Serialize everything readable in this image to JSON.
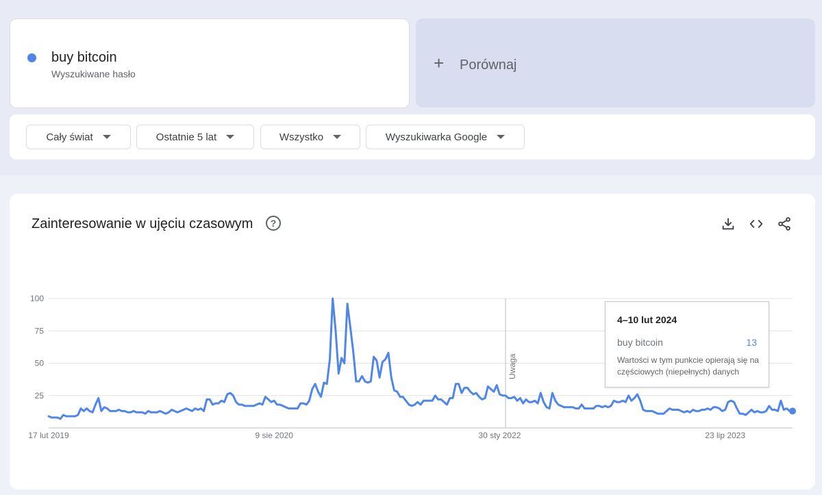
{
  "search_term": {
    "name": "buy bitcoin",
    "subtitle": "Wyszukiwane hasło",
    "color": "#4f86e8"
  },
  "compare": {
    "label": "Porównaj"
  },
  "filters": [
    {
      "label": "Cały świat"
    },
    {
      "label": "Ostatnie 5 lat"
    },
    {
      "label": "Wszystko"
    },
    {
      "label": "Wyszukiwarka Google"
    }
  ],
  "chart_card": {
    "title": "Zainteresowanie w ujęciu czasowym",
    "icons": [
      "help-icon",
      "download-icon",
      "embed-icon",
      "share-icon"
    ]
  },
  "tooltip": {
    "date": "4–10 lut 2024",
    "term": "buy bitcoin",
    "value": "13",
    "note": "Wartości w tym punkcie opierają się na częściowych (niepełnych) danych"
  },
  "chart_data": {
    "type": "line",
    "title": "Zainteresowanie w ujęciu czasowym",
    "xlabel": "",
    "ylabel": "",
    "ylim": [
      0,
      100
    ],
    "yticks": [
      25,
      50,
      75,
      100
    ],
    "x_tick_labels": [
      "17 lut 2019",
      "9 sie 2020",
      "30 sty 2022",
      "23 lip 2023"
    ],
    "x_tick_weeks": [
      0,
      77,
      154,
      231
    ],
    "annotation": {
      "label": "Uwaga",
      "week": 156
    },
    "grid": true,
    "series": [
      {
        "name": "buy bitcoin",
        "color": "#4f86e8",
        "values": [
          9,
          8,
          8,
          8,
          7,
          10,
          9,
          9,
          9,
          9,
          10,
          15,
          13,
          15,
          13,
          12,
          18,
          23,
          13,
          16,
          15,
          13,
          13,
          13,
          14,
          13,
          13,
          12,
          12,
          13,
          12,
          12,
          12,
          11,
          13,
          12,
          12,
          12,
          13,
          12,
          11,
          12,
          14,
          13,
          12,
          13,
          14,
          15,
          14,
          13,
          15,
          14,
          15,
          13,
          22,
          22,
          18,
          19,
          19,
          21,
          20,
          26,
          27,
          25,
          20,
          18,
          18,
          17,
          17,
          17,
          17,
          18,
          19,
          18,
          24,
          22,
          20,
          21,
          18,
          18,
          17,
          16,
          15,
          15,
          15,
          15,
          19,
          19,
          18,
          21,
          30,
          34,
          28,
          24,
          35,
          34,
          53,
          100,
          75,
          42,
          54,
          50,
          96,
          78,
          59,
          36,
          36,
          40,
          36,
          35,
          36,
          55,
          52,
          39,
          51,
          53,
          58,
          39,
          29,
          28,
          24,
          24,
          21,
          18,
          17,
          18,
          20,
          18,
          21,
          21,
          21,
          21,
          25,
          22,
          22,
          20,
          18,
          23,
          23,
          34,
          34,
          27,
          31,
          31,
          28,
          26,
          27,
          24,
          22,
          23,
          32,
          30,
          28,
          33,
          26,
          25,
          25,
          23,
          23,
          24,
          21,
          23,
          19,
          22,
          20,
          20,
          21,
          19,
          27,
          20,
          16,
          15,
          27,
          21,
          18,
          17,
          16,
          16,
          16,
          16,
          15,
          15,
          18,
          15,
          15,
          15,
          15,
          17,
          17,
          16,
          17,
          16,
          17,
          21,
          20,
          20,
          21,
          20,
          25,
          21,
          23,
          26,
          21,
          14,
          13,
          13,
          13,
          12,
          11,
          11,
          11,
          13,
          15,
          14,
          14,
          14,
          13,
          12,
          13,
          12,
          14,
          13,
          13,
          14,
          14,
          15,
          14,
          16,
          16,
          15,
          13,
          14,
          20,
          21,
          20,
          15,
          11,
          11,
          10,
          12,
          14,
          12,
          13,
          12,
          12,
          13,
          17,
          14,
          14,
          13,
          21,
          14,
          15,
          13,
          13
        ]
      }
    ]
  }
}
